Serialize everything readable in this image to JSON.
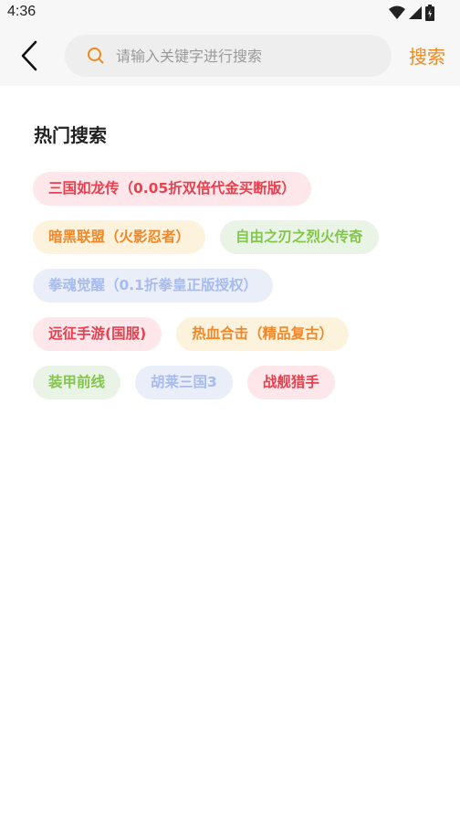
{
  "status_bar": {
    "time": "4:36",
    "icons": [
      "wifi-icon",
      "cellular-signal-icon",
      "battery-icon"
    ]
  },
  "header": {
    "back_icon": "chevron-left-icon",
    "search_icon": "search-icon",
    "search_placeholder": "请输入关键字进行搜索",
    "search_value": "",
    "search_button_label": "搜索"
  },
  "hot_search": {
    "title": "热门搜索",
    "rows": [
      [
        {
          "label": "三国如龙传（0.05折双倍代金买断版）",
          "color": "red"
        }
      ],
      [
        {
          "label": "暗黑联盟（火影忍者）",
          "color": "orange"
        },
        {
          "label": "自由之刃之烈火传奇",
          "color": "green"
        }
      ],
      [
        {
          "label": "拳魂觉醒（0.1折拳皇正版授权）",
          "color": "blue"
        }
      ],
      [
        {
          "label": "远征手游(国服)",
          "color": "red"
        },
        {
          "label": "热血合击（精品复古）",
          "color": "orange"
        }
      ],
      [
        {
          "label": "装甲前线",
          "color": "green"
        },
        {
          "label": "胡莱三国3",
          "color": "blue"
        },
        {
          "label": "战舰猎手",
          "color": "red"
        }
      ]
    ]
  },
  "colors": {
    "accent": "#ee8a1f",
    "tag_red_text": "#e8404f",
    "tag_red_bg": "#fde7ea",
    "tag_orange_text": "#f0882a",
    "tag_orange_bg": "#fdf3dc",
    "tag_green_text": "#82c64a",
    "tag_green_bg": "#e9f4e7",
    "tag_blue_text": "#a6bbee",
    "tag_blue_bg": "#eaeef9"
  }
}
